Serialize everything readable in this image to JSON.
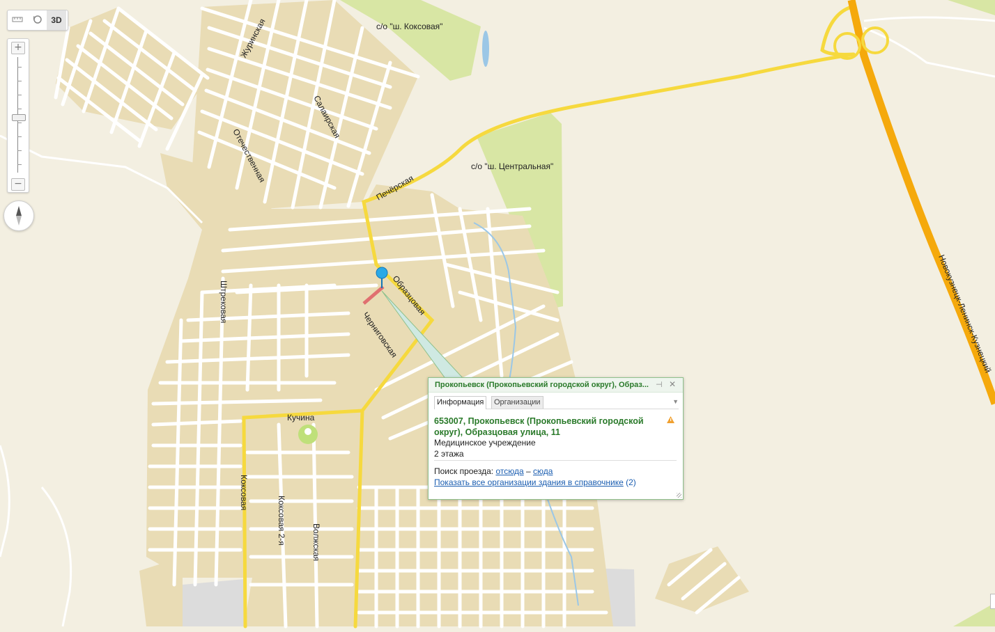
{
  "toolbar": {
    "ruler_icon": "ruler-icon",
    "magnifier_icon": "magnifier-icon",
    "mode_3d_label": "3D"
  },
  "zoom": {
    "plus_label": "+",
    "minus_label": "−"
  },
  "map": {
    "areas": {
      "koksovaya": "с/о \"ш. Коксовая\"",
      "centralnaya": "с/о \"ш. Центральная\""
    },
    "streets": {
      "zhurinskaya": "Журинская",
      "salairskaya": "Салаирская",
      "otechestvennaya": "Отечественная",
      "pecherskaya": "Печёрская",
      "obrazcovaya": "Образцовая",
      "chernigovskaya": "Черниговская",
      "shtrekovaya": "Штрековая",
      "kuchina": "Кучина",
      "koksovaya": "Коксовая",
      "koksovaya2": "Коксовая 2-я",
      "volzhskaya": "Волжская",
      "highway": "Новокузнецк-Ленинск-Кузнецкий"
    },
    "colors": {
      "background": "#f3efe1",
      "blocks": "#e9dcb5",
      "streets": "#ffffff",
      "main_road": "#f6d93e",
      "highway": "#f5a90c",
      "park": "#d8e6a4",
      "water": "#9bc7e6",
      "industrial": "#dcdcdc"
    }
  },
  "balloon": {
    "title": "Прокопьевск (Прокопьевский городской округ), Образ...",
    "pin_icon": "pin-icon",
    "close_icon": "close-icon",
    "tabs": [
      "Информация",
      "Организации"
    ],
    "address": "653007, Прокопьевск (Прокопьевский городской округ), Образцовая улица, 11",
    "type": "Медицинское учреждение",
    "floors": "2 этажа",
    "route_label": "Поиск проезда:",
    "route_from": "отсюда",
    "route_dash": "–",
    "route_to": "сюда",
    "show_all_link": "Показать все организации здания в справочнике",
    "show_all_count": "(2)"
  }
}
